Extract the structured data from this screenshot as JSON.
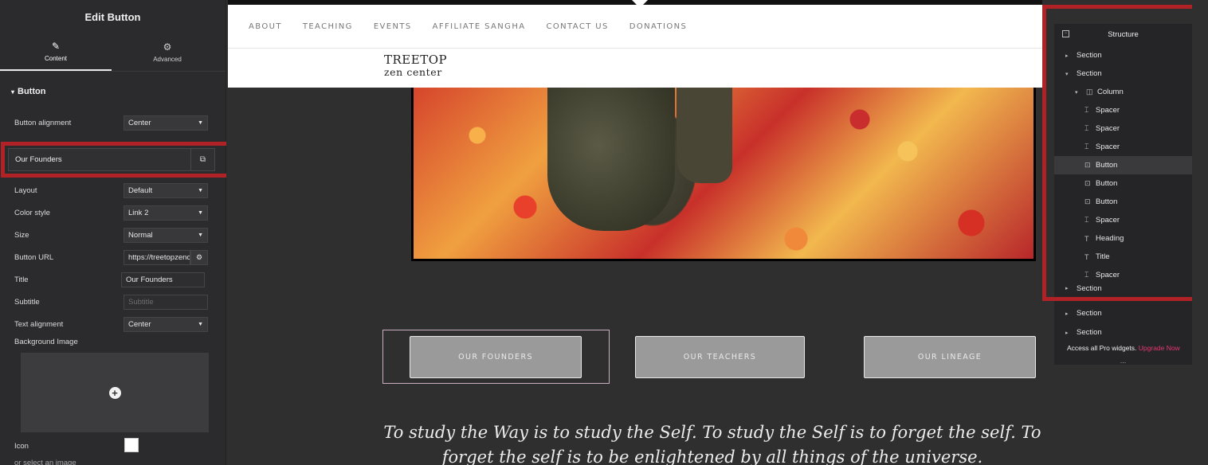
{
  "editor": {
    "title": "Edit Button",
    "tabs": [
      {
        "label": "Content",
        "icon": "pencil-icon"
      },
      {
        "label": "Advanced",
        "icon": "gear-icon"
      }
    ],
    "section": "Button",
    "alignment": {
      "label": "Button alignment",
      "value": "Center"
    },
    "item_title": "Our Founders",
    "fields": {
      "layout": {
        "label": "Layout",
        "value": "Default"
      },
      "color_style": {
        "label": "Color style",
        "value": "Link 2"
      },
      "size": {
        "label": "Size",
        "value": "Normal"
      },
      "url": {
        "label": "Button URL",
        "value": "https://treetopzenc"
      },
      "title": {
        "label": "Title",
        "value": "Our Founders"
      },
      "subtitle": {
        "label": "Subtitle",
        "placeholder": "Subtitle"
      },
      "text_alignment": {
        "label": "Text alignment",
        "value": "Center"
      },
      "background_image": {
        "label": "Background Image"
      },
      "icon": {
        "label": "Icon"
      },
      "select_image": {
        "label": "or select an image"
      }
    }
  },
  "site": {
    "nav": [
      "ABOUT",
      "TEACHING",
      "EVENTS",
      "AFFILIATE SANGHA",
      "CONTACT US",
      "DONATIONS"
    ],
    "logo_line1": "TREETOP",
    "logo_line2": "zen center",
    "buttons": [
      "OUR FOUNDERS",
      "OUR TEACHERS",
      "OUR LINEAGE"
    ],
    "quote": "To study the Way is to study the Self. To study the Self is to forget the self. To forget the self is to be enlightened by all things of the universe."
  },
  "structure": {
    "title": "Structure",
    "items": [
      {
        "label": "Section",
        "arrow": "▸",
        "icon": ""
      },
      {
        "label": "Section",
        "arrow": "▾",
        "icon": ""
      },
      {
        "label": "Column",
        "arrow": "▾",
        "icon": "◫"
      },
      {
        "label": "Spacer",
        "arrow": "",
        "icon": "⌶"
      },
      {
        "label": "Spacer",
        "arrow": "",
        "icon": "⌶"
      },
      {
        "label": "Spacer",
        "arrow": "",
        "icon": "⌶"
      },
      {
        "label": "Button",
        "arrow": "",
        "icon": "⊡"
      },
      {
        "label": "Button",
        "arrow": "",
        "icon": "⊡"
      },
      {
        "label": "Button",
        "arrow": "",
        "icon": "⊡"
      },
      {
        "label": "Spacer",
        "arrow": "",
        "icon": "⌶"
      },
      {
        "label": "Heading",
        "arrow": "",
        "icon": "T"
      },
      {
        "label": "Title",
        "arrow": "",
        "icon": "T"
      },
      {
        "label": "Spacer",
        "arrow": "",
        "icon": "⌶"
      },
      {
        "label": "Section",
        "arrow": "▸",
        "icon": ""
      },
      {
        "label": "Section",
        "arrow": "▸",
        "icon": ""
      },
      {
        "label": "Section",
        "arrow": "▸",
        "icon": ""
      }
    ],
    "pro_text": "Access all Pro widgets.",
    "pro_link": "Upgrade Now",
    "more": "..."
  },
  "colors": {
    "highlight": "#b02226",
    "accent": "#e5376f"
  }
}
